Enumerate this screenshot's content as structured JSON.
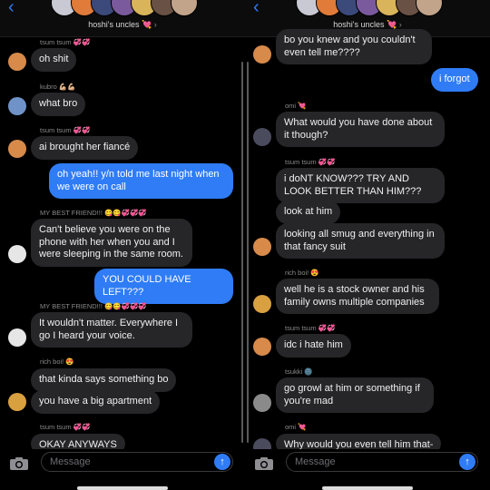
{
  "colors": {
    "outgoing_bubble": "#2f7cf6",
    "incoming_bubble": "#262629",
    "background": "#000000",
    "heart": "#e84fb0"
  },
  "left_panel": {
    "header": {
      "group_name": "hoshi's uncles",
      "heart_emoji": "💘",
      "chevron": "›",
      "back_icon": "‹"
    },
    "messages": [
      {
        "sender": "tsum tsum",
        "sender_emoji": "💞💞",
        "text": "oh shit",
        "outgoing": false
      },
      {
        "sender": "kubro",
        "sender_emoji": "💪🏼💪🏼",
        "text": "what bro",
        "outgoing": false
      },
      {
        "sender": "tsum tsum",
        "sender_emoji": "💞💞",
        "text": "ai brought her fiancé",
        "outgoing": false
      },
      {
        "text": "oh yeah!! y/n told me last night when we were on call",
        "outgoing": true
      },
      {
        "sender": "MY BEST FRIEND!!!",
        "sender_emoji": "😋😋💞💞💞",
        "text": "Can't believe you were on the phone with her when you and I were sleeping in the same room.",
        "outgoing": false
      },
      {
        "text": "YOU COULD HAVE LEFT???",
        "outgoing": true
      },
      {
        "sender": "MY BEST FRIEND!!!",
        "sender_emoji": "😋😋💞💞💞",
        "text": "It wouldn't matter. Everywhere I go I heard your voice.",
        "outgoing": false
      },
      {
        "sender": "rich boi!",
        "sender_emoji": "😍",
        "text": "that kinda says something bo",
        "outgoing": false
      },
      {
        "text": "you have a big apartment",
        "outgoing": false
      },
      {
        "sender": "tsum tsum",
        "sender_emoji": "💞💞",
        "text": "OKAY ANYWAYS",
        "outgoing": false
      }
    ],
    "input": {
      "placeholder": "Message",
      "send_icon": "↑",
      "camera_icon": "camera-icon"
    }
  },
  "right_panel": {
    "header": {
      "group_name": "hoshi's uncles",
      "heart_emoji": "💘",
      "chevron": "›",
      "back_icon": "‹"
    },
    "messages": [
      {
        "text": "bo you knew and you couldn't even tell me????",
        "outgoing": false
      },
      {
        "text": "i forgot",
        "outgoing": true
      },
      {
        "sender": "omi",
        "sender_emoji": "💘",
        "text": "What would you have done about it though?",
        "outgoing": false
      },
      {
        "sender": "tsum tsum",
        "sender_emoji": "💞💞",
        "text": "i doNT KNOW??? TRY AND LOOK BETTER THAN HIM???",
        "outgoing": false
      },
      {
        "text": "look at him",
        "outgoing": false
      },
      {
        "text": "looking all smug and everything in that fancy suit",
        "outgoing": false
      },
      {
        "sender": "rich boi!",
        "sender_emoji": "😍",
        "text": "well he is a stock owner and his family owns multiple companies",
        "outgoing": false
      },
      {
        "sender": "tsum tsum",
        "sender_emoji": "💞💞",
        "text": "idc i hate him",
        "outgoing": false
      },
      {
        "sender": "tsukki",
        "sender_emoji": "🌚",
        "text": "go growl at him or something if you're mad",
        "outgoing": false
      },
      {
        "sender": "omi",
        "sender_emoji": "💘",
        "text": "Why would you even tell him that-",
        "outgoing": false
      }
    ],
    "input": {
      "placeholder": "Message",
      "send_icon": "↑",
      "camera_icon": "camera-icon"
    }
  }
}
